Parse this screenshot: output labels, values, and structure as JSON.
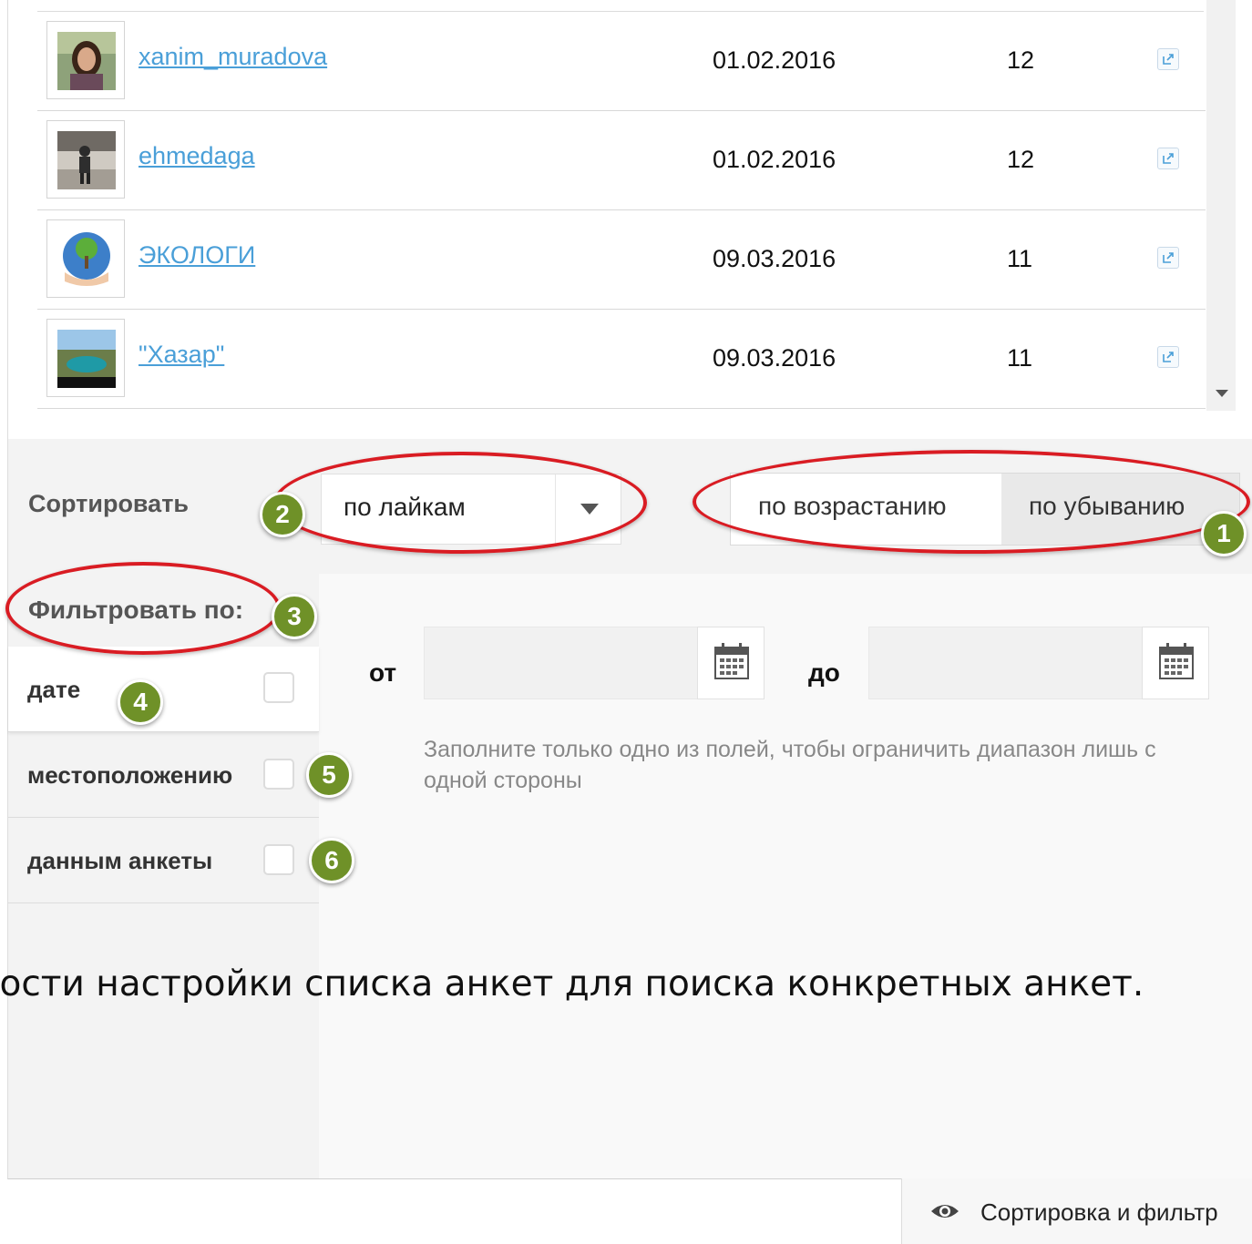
{
  "users": [
    {
      "name": "xanim_muradova",
      "date": "01.02.2016",
      "count": "12"
    },
    {
      "name": "ehmedaga",
      "date": "01.02.2016",
      "count": "12"
    },
    {
      "name": "ЭКОЛОГИ",
      "date": "09.03.2016",
      "count": "11"
    },
    {
      "name": "\"Хазар\"",
      "date": "09.03.2016",
      "count": "11"
    }
  ],
  "sort": {
    "label": "Сортировать",
    "select_value": "по лайкам",
    "ascending_label": "по возрастанию",
    "descending_label": "по убыванию",
    "active_order": "descending"
  },
  "filter": {
    "label": "Фильтровать по:",
    "tabs": [
      {
        "label": "дате"
      },
      {
        "label": "местоположению"
      },
      {
        "label": "данным анкеты"
      }
    ],
    "from_label": "от",
    "to_label": "до",
    "hint": "Заполните только одно из полей, чтобы ограничить диапазон лишь с одной стороны"
  },
  "annotations": {
    "badges": [
      "1",
      "2",
      "3",
      "4",
      "5",
      "6"
    ],
    "ring_color": "#d91c23",
    "badge_color": "#6f9128"
  },
  "caption": "ности настройки списка анкет для поиска конкретных анкет.",
  "bottom_bar": {
    "label": "Сортировка и фильтр",
    "icon": "eye-icon"
  },
  "link_color": "#4a9fd8"
}
